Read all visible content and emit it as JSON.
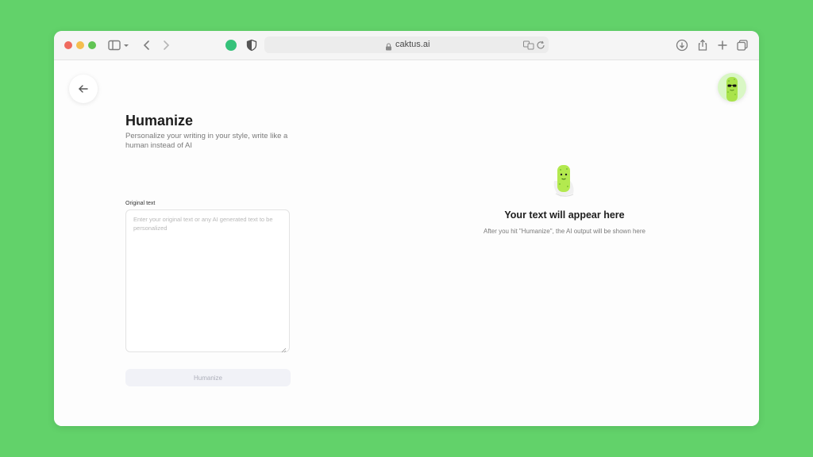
{
  "browser": {
    "url": "caktus.ai",
    "icons": {
      "sidebar": "sidebar-icon",
      "back": "chevron-left-icon",
      "forward": "chevron-right-icon",
      "shield": "shield-icon",
      "lock": "lock-icon",
      "translate": "translate-icon",
      "reload": "reload-icon",
      "download": "download-icon",
      "share": "share-icon",
      "new_tab": "plus-icon",
      "tabs": "tabs-overview-icon"
    }
  },
  "page": {
    "title": "Humanize",
    "subtitle": "Personalize your writing in your style, write like a human instead of AI",
    "input_label": "Original text",
    "input_placeholder": "Enter your original text or any AI generated text to be personalized",
    "input_value": "",
    "submit_label": "Humanize"
  },
  "output": {
    "title": "Your text will appear here",
    "subtitle": "After you hit \"Humanize\", the AI output will be shown here"
  },
  "colors": {
    "background": "#62d26a",
    "accent": "#7ed957",
    "button_bg": "#f1f2f7",
    "button_text": "#aeb0bb"
  }
}
